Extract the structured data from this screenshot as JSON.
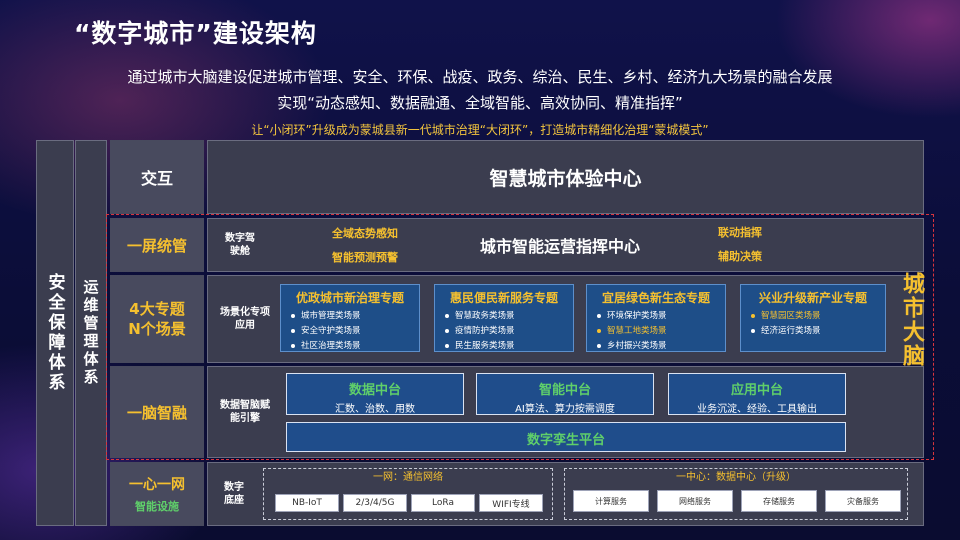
{
  "title": "“数字城市”建设架构",
  "subtitle_1": "通过城市大脑建设促进城市管理、安全、环保、战疫、政务、综治、民生、乡村、经济九大场景的融合发展",
  "subtitle_2": "实现“动态感知、数据融通、全域智能、高效协同、精准指挥”",
  "subtitle_3": "让“小闭环”升级成为蒙城县新一代城市治理“大闭环”，打造城市精细化治理“蒙城模式”",
  "left_columns": {
    "security": "安全保障体系",
    "ops": "运维管理体系"
  },
  "city_brain_label": "城市大脑",
  "rows": {
    "interaction": {
      "label": "交互",
      "center": "智慧城市体验中心"
    },
    "one_screen": {
      "label": "一屏统管",
      "sub": "数字驾驶舱",
      "left_top": "全域态势感知",
      "left_bottom": "智能预测预警",
      "center": "城市智能运营指挥中心",
      "right_top": "联动指挥",
      "right_bottom": "辅助决策"
    },
    "topics": {
      "label_1": "4大专题",
      "label_2": "N个场景",
      "sub": "场景化专项应用",
      "cards": [
        {
          "title": "优政城市新治理专题",
          "items": [
            "城市管理类场景",
            "安全守护类场景",
            "社区治理类场景"
          ]
        },
        {
          "title": "惠民便民新服务专题",
          "items": [
            "智慧政务类场景",
            "疫情防护类场景",
            "民生服务类场景"
          ]
        },
        {
          "title": "宜居绿色新生态专题",
          "items": [
            "环境保护类场景",
            "智慧工地类场景",
            "乡村振兴类场景"
          ]
        },
        {
          "title": "兴业升级新产业专题",
          "items": [
            "智慧园区类场景",
            "经济运行类场景"
          ]
        }
      ]
    },
    "one_brain": {
      "label": "一脑智融",
      "sub": "数据智脑赋能引擎",
      "platforms": [
        {
          "title": "数据中台",
          "desc": "汇数、治数、用数"
        },
        {
          "title": "智能中台",
          "desc": "AI算法、算力按需调度"
        },
        {
          "title": "应用中台",
          "desc": "业务沉淀、经验、工具输出"
        }
      ],
      "twin": "数字孪生平台"
    },
    "infra": {
      "label": "一心一网",
      "label_sub": "智能设施",
      "sub": "数字底座",
      "network_title": "一网：通信网络",
      "network_items": [
        "NB-IoT",
        "2/3/4/5G",
        "LoRa",
        "WIFI专线"
      ],
      "center_title": "一中心：数据中心（升级）",
      "center_items": [
        "计算服务",
        "网络服务",
        "存储服务",
        "灾备服务"
      ]
    }
  },
  "colors": {
    "accent_gold": "#f5c02f",
    "platform_green": "#5fcf6a",
    "brain_border_red": "#d8353d"
  }
}
